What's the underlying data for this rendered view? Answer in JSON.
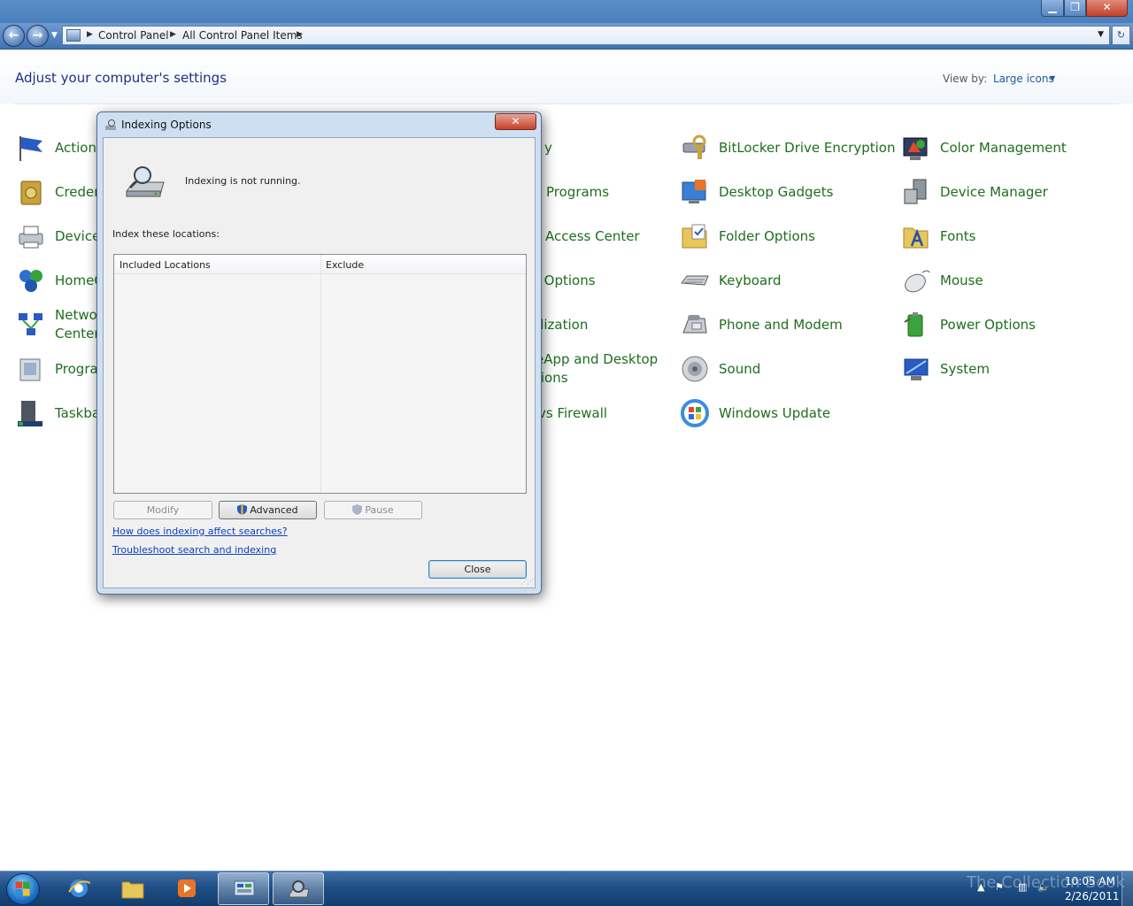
{
  "window": {
    "min_icon": "minimize-icon",
    "max_icon": "restore-icon",
    "close_icon": "close-icon"
  },
  "nav": {
    "back_icon": "back-arrow-icon",
    "forward_icon": "forward-arrow-icon",
    "breadcrumbs": [
      "Control Panel",
      "All Control Panel Items"
    ],
    "refresh_icon": "refresh-icon"
  },
  "header": {
    "title": "Adjust your computer's settings",
    "view_by_label": "View by:",
    "view_by_value": "Large icons"
  },
  "items": {
    "col1": [
      {
        "label": "Action",
        "icon": "flag-icon"
      },
      {
        "label": "Creden",
        "icon": "vault-icon"
      },
      {
        "label": "Device",
        "icon": "printer-icon"
      },
      {
        "label": "HomeG",
        "icon": "homegroup-icon"
      },
      {
        "label": "Netwo\nCenter",
        "icon": "network-icon"
      },
      {
        "label": "Progra",
        "icon": "programs-icon"
      },
      {
        "label": "Taskba",
        "icon": "taskbar-icon"
      }
    ],
    "col3": [
      {
        "label": "y"
      },
      {
        "label": "Programs"
      },
      {
        "label": "Access Center"
      },
      {
        "label": "t Options"
      },
      {
        "label": "alization"
      },
      {
        "label": "eApp and Desktop\ntions"
      },
      {
        "label": "vs Firewall"
      }
    ],
    "col4": [
      {
        "label": "BitLocker Drive Encryption",
        "icon": "bitlocker-icon"
      },
      {
        "label": "Desktop Gadgets",
        "icon": "gadgets-icon"
      },
      {
        "label": "Folder Options",
        "icon": "folder-options-icon"
      },
      {
        "label": "Keyboard",
        "icon": "keyboard-icon"
      },
      {
        "label": "Phone and Modem",
        "icon": "phone-icon"
      },
      {
        "label": "Sound",
        "icon": "speaker-icon"
      },
      {
        "label": "Windows Update",
        "icon": "windows-update-icon"
      }
    ],
    "col5": [
      {
        "label": "Color Management",
        "icon": "color-management-icon"
      },
      {
        "label": "Device Manager",
        "icon": "device-manager-icon"
      },
      {
        "label": "Fonts",
        "icon": "fonts-icon"
      },
      {
        "label": "Mouse",
        "icon": "mouse-icon"
      },
      {
        "label": "Power Options",
        "icon": "power-icon"
      },
      {
        "label": "System",
        "icon": "system-icon"
      }
    ]
  },
  "dialog": {
    "title": "Indexing Options",
    "status": "Indexing is not running.",
    "index_label": "Index these locations:",
    "col_included": "Included Locations",
    "col_exclude": "Exclude",
    "btn_modify": "Modify",
    "btn_advanced": "Advanced",
    "btn_pause": "Pause",
    "link_how": "How does indexing affect searches?",
    "link_troubleshoot": "Troubleshoot search and indexing",
    "btn_close": "Close"
  },
  "taskbar": {
    "watermark": "The Collection Book",
    "time": "10:05 AM",
    "date": "2/26/2011"
  }
}
